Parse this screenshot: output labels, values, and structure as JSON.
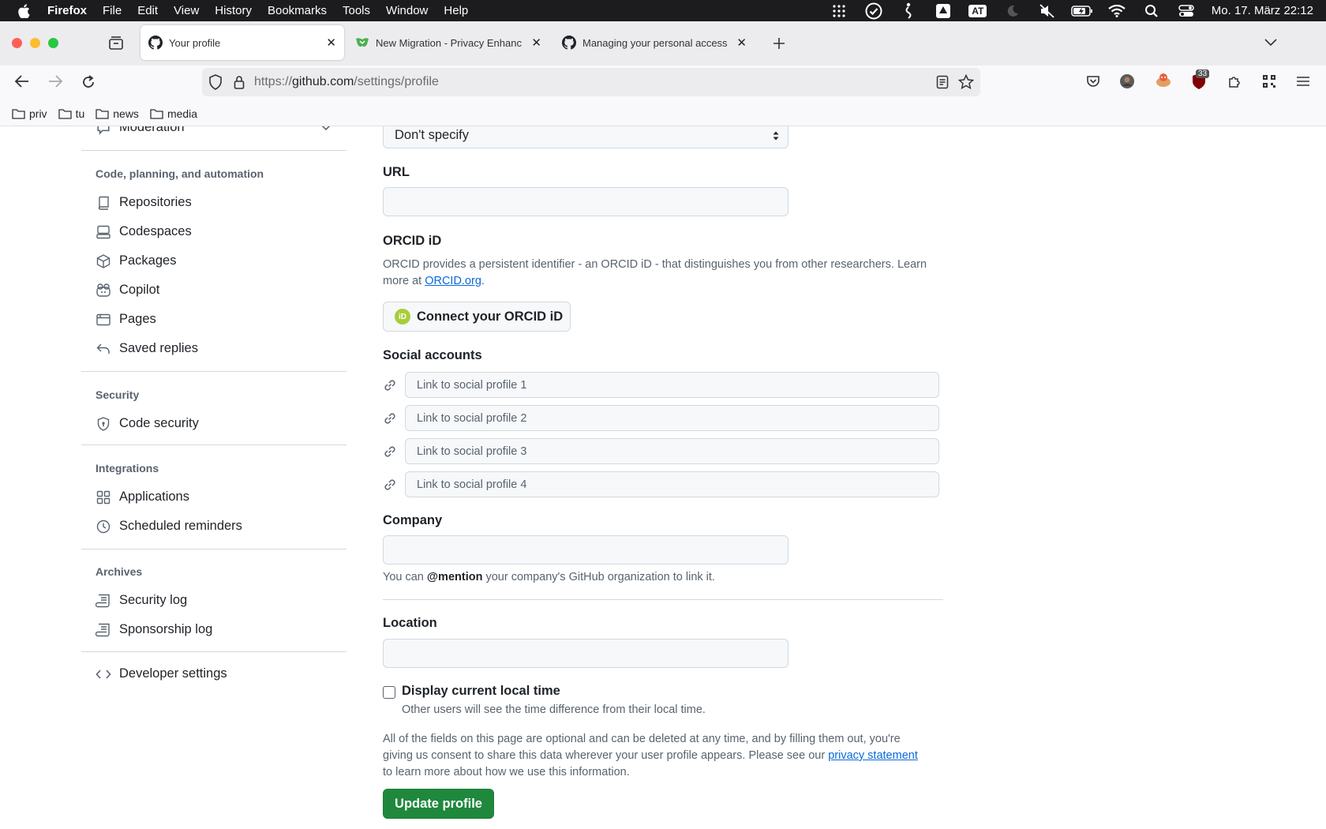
{
  "menubar": {
    "app": "Firefox",
    "items": [
      "File",
      "Edit",
      "View",
      "History",
      "Bookmarks",
      "Tools",
      "Window",
      "Help"
    ],
    "clock": "Mo. 17. März  22:12",
    "tray_icons": [
      "grid-icon",
      "checkmark-circle-icon",
      "accessibility-icon",
      "drive-icon",
      "at-badge-icon",
      "moon-icon",
      "mute-icon",
      "battery-icon",
      "wifi-icon",
      "search-icon",
      "control-center-icon"
    ],
    "at_badge": "AT"
  },
  "tabs": [
    {
      "title": "Your profile",
      "active": true
    },
    {
      "title": "New Migration - Privacy Enhanc",
      "active": false
    },
    {
      "title": "Managing your personal access",
      "active": false
    }
  ],
  "urlbar": {
    "scheme": "https://",
    "host": "github.com",
    "path": "/settings/profile"
  },
  "toolbar": {
    "extension_badge": "33"
  },
  "bookmarks": [
    "priv",
    "tu",
    "news",
    "media"
  ],
  "sidebar": {
    "moderation": "Moderation",
    "sections": [
      {
        "heading": "Code, planning, and automation",
        "items": [
          "Repositories",
          "Codespaces",
          "Packages",
          "Copilot",
          "Pages",
          "Saved replies"
        ]
      },
      {
        "heading": "Security",
        "items": [
          "Code security"
        ]
      },
      {
        "heading": "Integrations",
        "items": [
          "Applications",
          "Scheduled reminders"
        ]
      },
      {
        "heading": "Archives",
        "items": [
          "Security log",
          "Sponsorship log"
        ]
      }
    ],
    "developer": "Developer settings"
  },
  "form": {
    "pronouns_select": "Don't specify",
    "url_label": "URL",
    "url_value": "",
    "orcid_label": "ORCID iD",
    "orcid_help_1": "ORCID provides a persistent identifier - an ORCID iD - that distinguishes you from other researchers. Learn",
    "orcid_help_2a": "more at ",
    "orcid_link": "ORCID.org",
    "orcid_help_2b": ".",
    "orcid_button": "Connect your ORCID iD",
    "orcid_badge": "iD",
    "social_label": "Social accounts",
    "social_placeholders": [
      "Link to social profile 1",
      "Link to social profile 2",
      "Link to social profile 3",
      "Link to social profile 4"
    ],
    "company_label": "Company",
    "company_value": "",
    "company_help_a": "You can ",
    "company_help_b": "@mention",
    "company_help_c": " your company's GitHub organization to link it.",
    "location_label": "Location",
    "location_value": "",
    "local_time_label": "Display current local time",
    "local_time_checked": false,
    "local_time_help": "Other users will see the time difference from their local time.",
    "consent_1": "All of the fields on this page are optional and can be deleted at any time, and by filling them out, you're",
    "consent_2": "giving us consent to share this data wherever your user profile appears. Please see our ",
    "consent_link": "privacy statement",
    "consent_3": "to learn more about how we use this information.",
    "update_button": "Update profile"
  },
  "colors": {
    "primary_button": "#1f883d",
    "link": "#0969da",
    "orcid": "#a6ce39"
  }
}
